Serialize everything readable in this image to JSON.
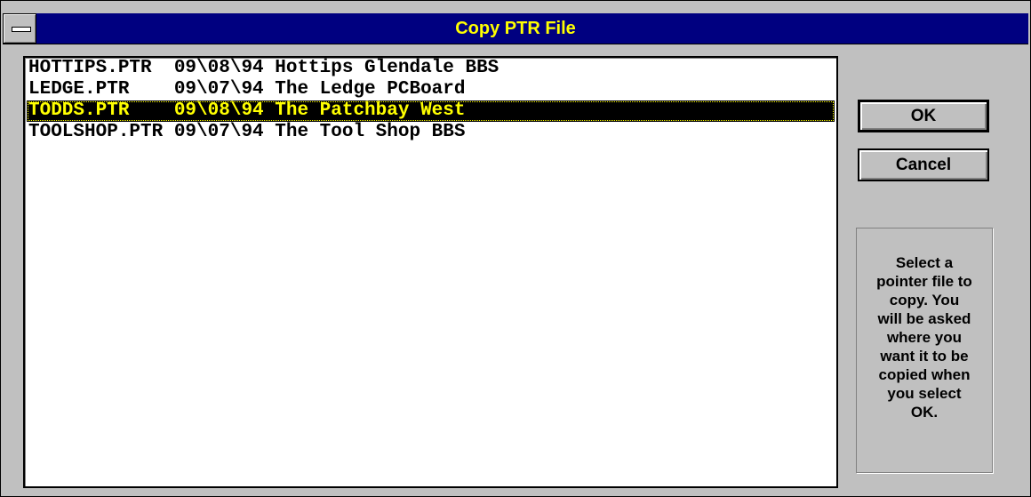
{
  "window": {
    "title": "Copy PTR File"
  },
  "list": {
    "items": [
      {
        "text": "HOTTIPS.PTR  09\\08\\94 Hottips Glendale BBS",
        "selected": false
      },
      {
        "text": "LEDGE.PTR    09\\07\\94 The Ledge PCBoard",
        "selected": false
      },
      {
        "text": "TODDS.PTR    09\\08\\94 The Patchbay West",
        "selected": true
      },
      {
        "text": "TOOLSHOP.PTR 09\\07\\94 The Tool Shop BBS",
        "selected": false
      }
    ]
  },
  "buttons": {
    "ok_label": "OK",
    "cancel_label": "Cancel"
  },
  "help": {
    "text": "Select a\npointer file to\ncopy.  You\nwill be asked\nwhere you\nwant it to be\ncopied when\nyou select\nOK."
  },
  "colors": {
    "titlebar": "#000080",
    "title_text": "#ffff00",
    "selection_bg": "#000000",
    "selection_text": "#ffff00",
    "face": "#c0c0c0"
  }
}
